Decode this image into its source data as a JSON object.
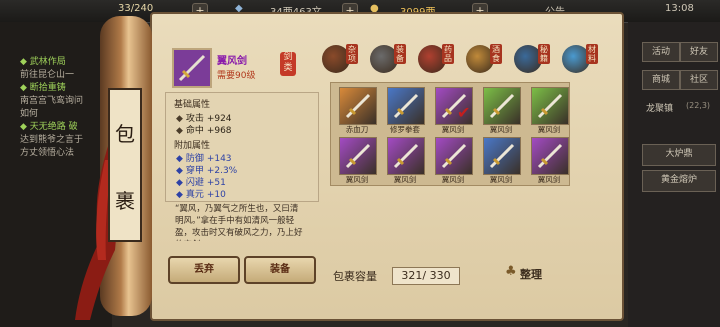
{
  "topbar": {
    "stamina": "33/240",
    "copper": "34两463文",
    "gold": "3099两",
    "announce": "公告",
    "time": "13:08"
  },
  "quests": [
    {
      "text": "◆ 武林作局",
      "highlight": true
    },
    {
      "text": "前往昆仑山一",
      "highlight": false
    },
    {
      "text": "◆ 断拾重铸",
      "highlight": true
    },
    {
      "text": "南宫宫飞鸾询问",
      "highlight": false
    },
    {
      "text": "如何",
      "highlight": false
    },
    {
      "text": "◆ 天无绝路 破",
      "highlight": true
    },
    {
      "text": "达到熊爷之言于",
      "highlight": false
    },
    {
      "text": "方丈领悟心法",
      "highlight": false
    }
  ],
  "scroll": {
    "title_1": "包",
    "title_2": "裹"
  },
  "item": {
    "name": "翼风剑",
    "requirement": "需要90级",
    "type": "剑类",
    "base_title": "基础属性",
    "base_attrs": [
      {
        "label": "攻击",
        "value": "+924"
      },
      {
        "label": "命中",
        "value": "+968"
      }
    ],
    "extra_title": "附加属性",
    "extra_attrs": [
      {
        "label": "防御",
        "value": "+143"
      },
      {
        "label": "穿甲",
        "value": "+2.3%"
      },
      {
        "label": "闪避",
        "value": "+51"
      },
      {
        "label": "真元",
        "value": "+10"
      }
    ],
    "description": "“翼风，乃翼气之所生也，又曰清明风。”拿在手中有如清风一般轻盈，攻击时又有破风之力，乃上好的宝剑",
    "discard_label": "丢弃",
    "equip_label": "装备"
  },
  "tabs": [
    "杂项",
    "装备",
    "药品",
    "酒食",
    "秘籍",
    "材料"
  ],
  "inventory": [
    {
      "name": "赤血刀",
      "color": "#d98a3a"
    },
    {
      "name": "修罗拳套",
      "color": "#4a78c8"
    },
    {
      "name": "翼风剑",
      "color": "#a34bc4"
    },
    {
      "name": "翼风剑",
      "color": "#7cbf47"
    },
    {
      "name": "翼风剑",
      "color": "#7cbf47"
    },
    {
      "name": "翼风剑",
      "color": "#a34bc4"
    },
    {
      "name": "翼风剑",
      "color": "#a34bc4"
    },
    {
      "name": "翼风剑",
      "color": "#a34bc4"
    },
    {
      "name": "翼风剑",
      "color": "#4a78c8"
    },
    {
      "name": "翼风剑",
      "color": "#a34bc4"
    }
  ],
  "capacity_label": "包裹容量",
  "capacity_value": "321/ 330",
  "sort_label": "整理",
  "right": {
    "row1": [
      "活动",
      "好友"
    ],
    "row2": [
      "商城",
      "社区"
    ],
    "location": "龙聚镇",
    "location_coord": "(22,3)",
    "action1": "大炉鼎",
    "action2": "黄金熔炉"
  },
  "colors": {
    "accent_red": "#c43a28",
    "epic_purple": "#8a1cab"
  }
}
